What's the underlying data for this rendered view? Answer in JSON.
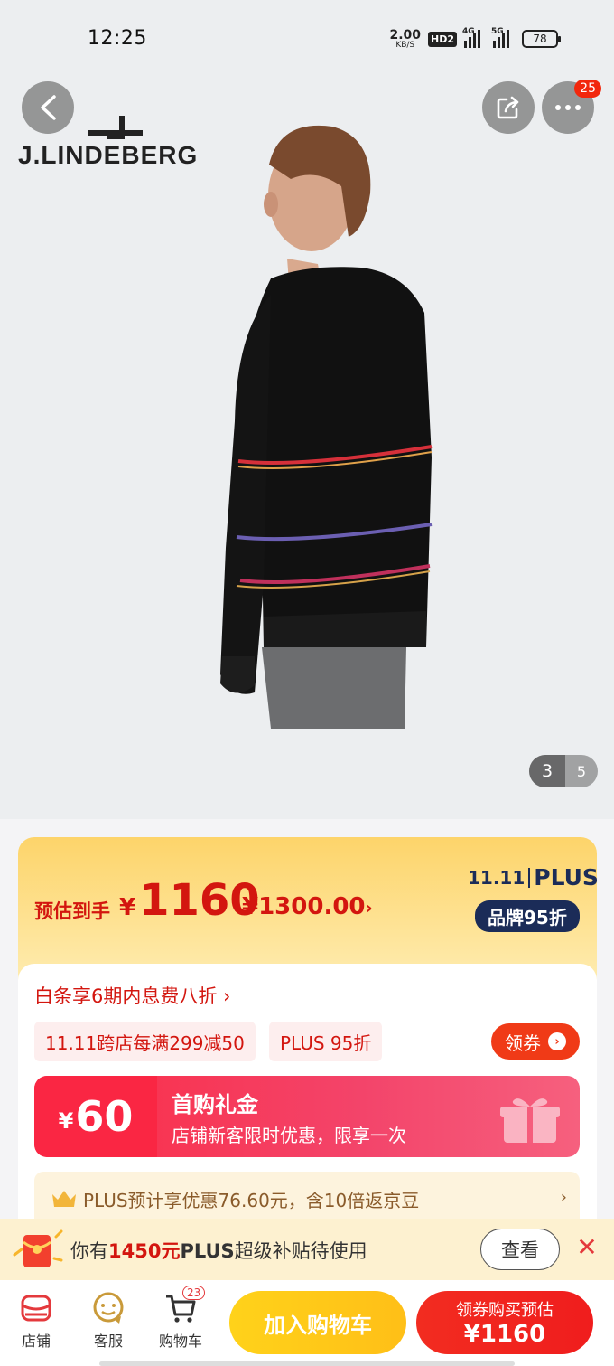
{
  "status_bar": {
    "time": "12:25",
    "net_speed_value": "2.00",
    "net_speed_unit": "KB/S",
    "hd_label": "HD2",
    "signal_1_label": "4G",
    "signal_2_label": "5G",
    "battery_level": "78"
  },
  "hero": {
    "brand_logo_text": "J.LINDEBERG",
    "more_badge_count": "25",
    "image_current": "3",
    "image_total": "5"
  },
  "price": {
    "label": "预估到手",
    "currency": "¥",
    "value": "1160",
    "original_price": "¥1300.00",
    "original_chevron": "›",
    "plus_logo_event": "11.11",
    "plus_logo_text": "PLUS",
    "plus_discount": "品牌95折"
  },
  "promo": {
    "baitiao_text": "白条享6期内息费八折 ›",
    "chips": [
      "11.11跨店每满299减50",
      "PLUS 95折"
    ],
    "coupon_button": "领券",
    "coupon_arrow": "›",
    "gift_currency": "¥",
    "gift_amount": "60",
    "gift_title": "首购礼金",
    "gift_subtitle": "店铺新客限时优惠，限享一次",
    "plus_save_text": "PLUS预计享优惠76.60元，含10倍返京豆",
    "plus_save_chevron": "›"
  },
  "subsidy": {
    "prefix": "你有",
    "amount": "1450元",
    "plus": "PLUS",
    "suffix": "超级补贴待使用",
    "view_button": "查看",
    "close": "✕"
  },
  "bottom_nav": {
    "store_label": "店铺",
    "service_label": "客服",
    "cart_label": "购物车",
    "cart_count": "23",
    "add_to_cart": "加入购物车",
    "buy_line1": "领券购买预估",
    "buy_line2": "¥1160"
  },
  "colors": {
    "accent_red": "#d3160f",
    "brand_red": "#f22c20",
    "cart_yellow": "#ffbf17",
    "plus_navy": "#1b2c58"
  }
}
